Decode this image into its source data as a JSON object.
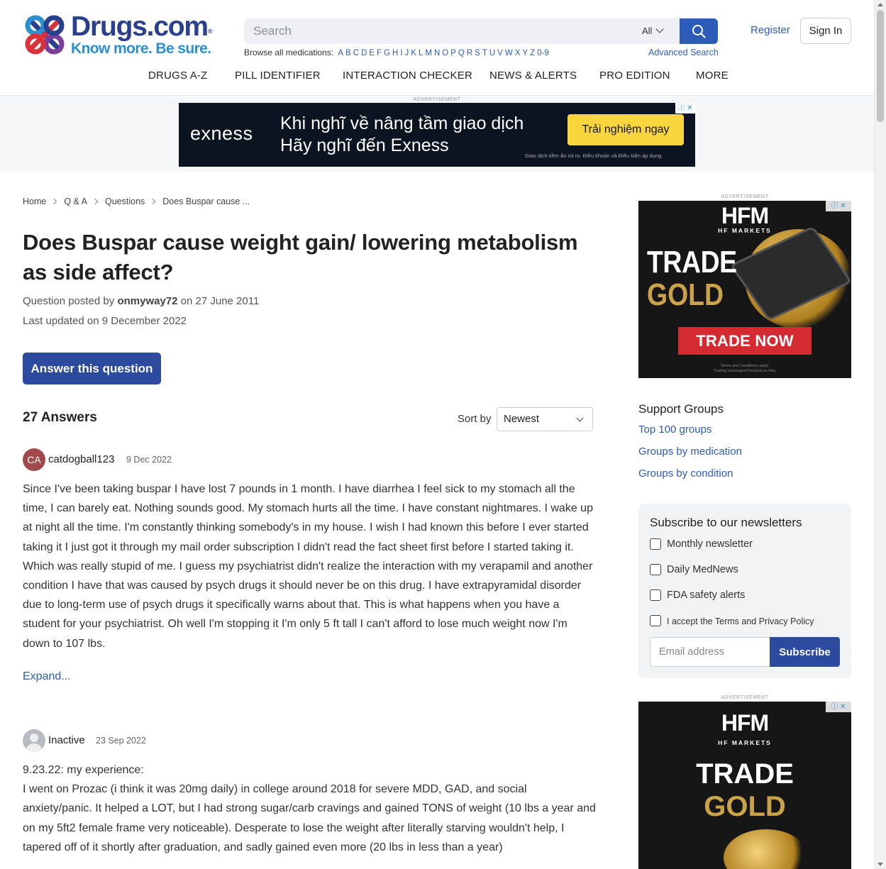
{
  "header": {
    "logo_text": "Drugs.com",
    "logo_tagline": "Know more. Be sure.",
    "search_placeholder": "Search",
    "search_scope": "All",
    "browse_label": "Browse all medications:",
    "browse_letters": [
      "A",
      "B",
      "C",
      "D",
      "E",
      "F",
      "G",
      "H",
      "I",
      "J",
      "K",
      "L",
      "M",
      "N",
      "O",
      "P",
      "Q",
      "R",
      "S",
      "T",
      "U",
      "V",
      "W",
      "X",
      "Y",
      "Z",
      "0-9"
    ],
    "advanced_search": "Advanced Search",
    "register": "Register",
    "sign_in": "Sign In",
    "nav": [
      "DRUGS A-Z",
      "PILL IDENTIFIER",
      "INTERACTION CHECKER",
      "NEWS & ALERTS",
      "PRO EDITION",
      "MORE"
    ]
  },
  "ads": {
    "label": "ADVERTISEMENT",
    "top": {
      "brand": "exness",
      "line1": "Khi nghĩ về nâng tầm giao dịch",
      "line2": "Hãy nghĩ đến Exness",
      "cta": "Trải nghiệm ngay",
      "fine": "Giao dịch tiềm ẩn rủi ro. Điều khoản và Điều kiện áp dụng."
    },
    "side": {
      "brand": "HFM",
      "brand_sub": "HF MARKETS",
      "line1": "TRADE",
      "line2": "GOLD",
      "cta": "TRADE NOW",
      "fine1": "Terms and Conditions apply.",
      "fine2": "Trading Leveraged Products is risky."
    }
  },
  "breadcrumb": [
    "Home",
    "Q & A",
    "Questions",
    "Does Buspar cause ..."
  ],
  "question": {
    "title": "Does Buspar cause weight gain/ lowering metabolism as side affect?",
    "posted_prefix": "Question posted by",
    "author": "onmyway72",
    "posted_on": "on 27 June 2011",
    "last_updated": "Last updated on 9 December 2022",
    "answer_button": "Answer this question"
  },
  "answers": {
    "count_label": "27 Answers",
    "sort_label": "Sort by",
    "sort_value": "Newest",
    "items": [
      {
        "initials": "CA",
        "user": "catdogball123",
        "date": "9 Dec 2022",
        "body": "Since I've been taking buspar I have lost 7 pounds in 1 month. I have diarrhea I feel sick to my stomach all the time, I can barely eat. Nothing sounds good. My stomach hurts all the time. I have constant nightmares. I wake up at night all the time. I'm constantly thinking somebody's in my house. I wish I had known this before I ever started taking it I just got it through my mail order subscription I didn't read the fact sheet first before I started taking it. Which was really stupid of me. I guess my psychiatrist didn't realize the interaction with my verapamil and another condition I have that was caused by psych drugs it should never be on this drug. I have extrapyramidal disorder due to long-term use of psych drugs it specifically warns about that. This is what happens when you have a student for your psychiatrist. Oh well I'm stopping it I'm only 5 ft tall I can't afford to lose much weight now I'm down to 107 lbs.",
        "expand": "Expand..."
      },
      {
        "initials": "",
        "user": "Inactive",
        "date": "23 Sep 2022",
        "body_line1": "9.23.22: my experience:",
        "body": "I went on Prozac (i think it was 20mg daily) in college around 2018 for severe MDD, GAD, and social anxiety/panic. It helped a LOT, but I had strong sugar/carb cravings and gained TONS of weight (10 lbs a year and on my 5ft2 female frame very noticeable). Desperate to lose the weight after literally starving wouldn't help, I tapered off of it shortly after graduation, and sadly gained even more (20 lbs in less than a year)"
      }
    ]
  },
  "sidebar": {
    "support_title": "Support Groups",
    "support_links": [
      "Top 100 groups",
      "Groups by medication",
      "Groups by condition"
    ],
    "newsletter": {
      "title": "Subscribe to our newsletters",
      "options": [
        "Monthly newsletter",
        "Daily MedNews",
        "FDA safety alerts"
      ],
      "accept": "I accept the Terms and Privacy Policy",
      "email_placeholder": "Email address",
      "subscribe": "Subscribe"
    }
  }
}
